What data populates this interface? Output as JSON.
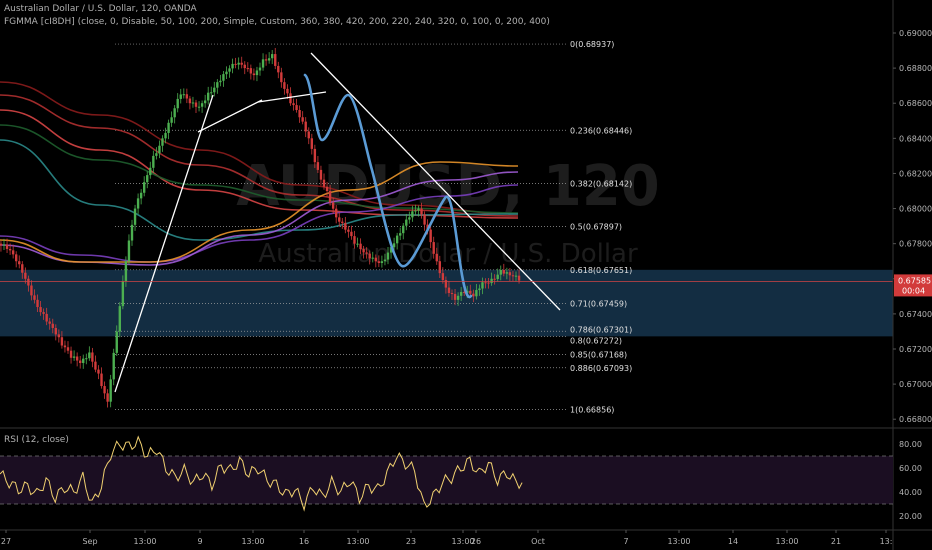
{
  "header": {
    "symbol_line": "Australian Dollar / U.S. Dollar, 120, OANDA",
    "indicator_line": "FGMMA [cI8DH] (close, 0, Disable, 50, 100, 200, Simple, Custom, 360, 380, 420, 200, 220, 240, 320, 0, 100, 0, 200, 400)"
  },
  "watermark": {
    "symbol": "AUDUSD, 120",
    "name": "Australian Dollar / U.S. Dollar"
  },
  "colors": {
    "background": "#000000",
    "candle_up": "#4caf50",
    "candle_down": "#d23b3b",
    "rsi_line": "#f0d070",
    "rsi_band": "#1b0e22",
    "zone_fill": "#16354e",
    "price_tag": "#d23b3b",
    "fib_lines": "#9e9e9e",
    "pattern_line": "#5b9bd5",
    "trend_line": "#ffffff",
    "ma_colors": [
      "#8a1c1c",
      "#b03030",
      "#d64545",
      "#1e5e2e",
      "#2a8a8a",
      "#7a3fbf",
      "#a05cd6",
      "#e8942a"
    ]
  },
  "price_axis": {
    "labels": [
      "0.69000",
      "0.68800",
      "0.68600",
      "0.68400",
      "0.68200",
      "0.68000",
      "0.67800",
      "0.67600",
      "0.67400",
      "0.67200",
      "0.67000",
      "0.66800"
    ],
    "current_price": "0.67585",
    "countdown": "00:04"
  },
  "fib_levels": [
    {
      "label": "0(0.68937)",
      "price": 0.68937
    },
    {
      "label": "0.236(0.68446)",
      "price": 0.68446
    },
    {
      "label": "0.382(0.68142)",
      "price": 0.68142
    },
    {
      "label": "0.5(0.67897)",
      "price": 0.67897
    },
    {
      "label": "0.618(0.67651)",
      "price": 0.67651
    },
    {
      "label": "0.71(0.67459)",
      "price": 0.67459
    },
    {
      "label": "0.786(0.67301)",
      "price": 0.67301
    },
    {
      "label": "0.8(0.67272)",
      "price": 0.67272
    },
    {
      "label": "0.85(0.67168)",
      "price": 0.67168
    },
    {
      "label": "0.886(0.67093)",
      "price": 0.67093
    },
    {
      "label": "1(0.66856)",
      "price": 0.66856
    }
  ],
  "time_axis": {
    "labels": [
      "27",
      "Sep",
      "13:00",
      "9",
      "13:00",
      "16",
      "13:00",
      "23",
      "13:00",
      "26",
      "13:00",
      "Oct",
      "7",
      "13:00",
      "14",
      "13:00",
      "21",
      "13:"
    ]
  },
  "rsi": {
    "label": "RSI (12, close)",
    "axis_labels": [
      "80.00",
      "60.00",
      "40.00",
      "20.00"
    ],
    "upper_band": 70,
    "lower_band": 30
  },
  "chart_data": [
    {
      "type": "line",
      "title": "Australian Dollar / U.S. Dollar, 120, OANDA",
      "series": [
        {
          "name": "AUDUSD close (approx.)",
          "values": [
            0.6777,
            0.677,
            0.676,
            0.6748,
            0.674,
            0.6732,
            0.6722,
            0.6715,
            0.6712,
            0.6718,
            0.6706,
            0.669,
            0.673,
            0.677,
            0.68,
            0.6815,
            0.683,
            0.684,
            0.6852,
            0.6865,
            0.686,
            0.6858,
            0.6866,
            0.6872,
            0.6878,
            0.6882,
            0.688,
            0.6876,
            0.6885,
            0.6888,
            0.6872,
            0.686,
            0.6852,
            0.684,
            0.6822,
            0.681,
            0.6795,
            0.6788,
            0.678,
            0.6775,
            0.6772,
            0.677,
            0.6778,
            0.6786,
            0.6795,
            0.68,
            0.6788,
            0.677,
            0.6755,
            0.6748,
            0.6752,
            0.675,
            0.6758,
            0.676,
            0.6765,
            0.6762,
            0.6759
          ]
        }
      ],
      "ylim": [
        0.6675,
        0.6905
      ],
      "grid": false
    },
    {
      "type": "line",
      "title": "RSI (12, close)",
      "series": [
        {
          "name": "RSI",
          "values": [
            55,
            48,
            42,
            45,
            38,
            50,
            35,
            44,
            40,
            52,
            30,
            45,
            72,
            80,
            78,
            82,
            70,
            76,
            60,
            52,
            58,
            48,
            55,
            46,
            62,
            58,
            66,
            55,
            60,
            50,
            46,
            38,
            42,
            30,
            44,
            36,
            48,
            40,
            50,
            35,
            45,
            42,
            55,
            70,
            64,
            58,
            28,
            36,
            48,
            52,
            60,
            66,
            55,
            64,
            50,
            56,
            48
          ]
        }
      ],
      "ylim": [
        15,
        90
      ],
      "grid": false
    }
  ]
}
